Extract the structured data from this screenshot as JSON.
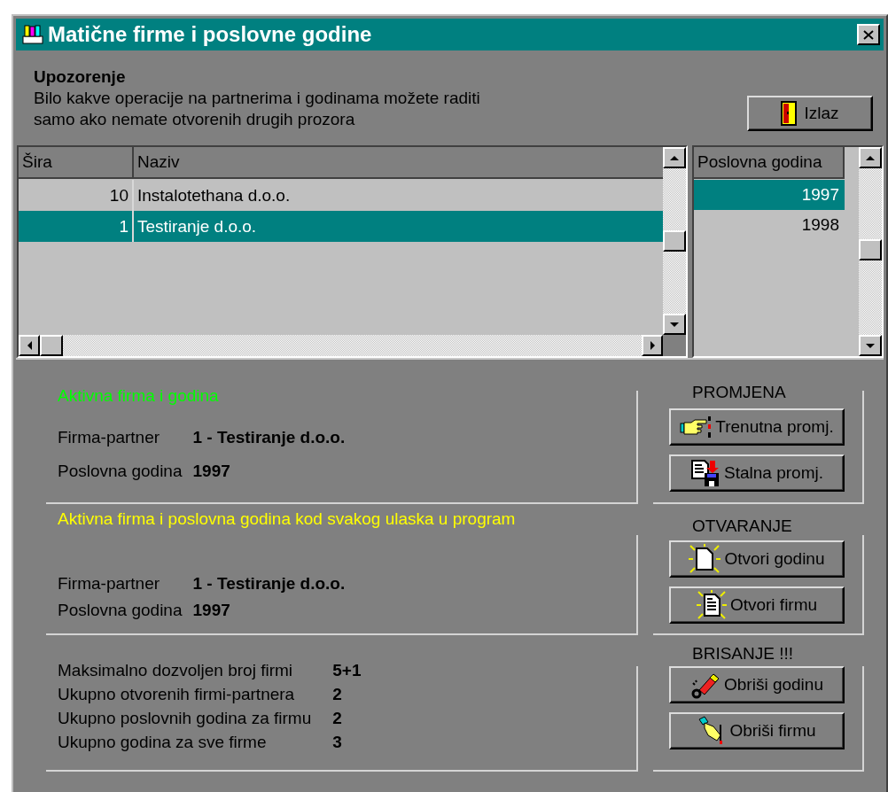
{
  "window": {
    "title": "Matične firme i poslovne godine"
  },
  "warning": {
    "heading": "Upozorenje",
    "lines": [
      "Bilo kakve operacije na partnerima i godinama možete raditi",
      "samo ako nemate otvorenih drugih prozora"
    ]
  },
  "exit_button": {
    "label": "Izlaz"
  },
  "firms_table": {
    "columns": [
      "Šira",
      "Naziv"
    ],
    "rows": [
      {
        "cells": [
          "10",
          "Instalotethana d.o.o."
        ],
        "selected": false
      },
      {
        "cells": [
          "1",
          "Testiranje d.o.o."
        ],
        "selected": true
      }
    ]
  },
  "years_list": {
    "column": "Poslovna godina",
    "items": [
      {
        "label": "1997",
        "selected": true
      },
      {
        "label": "1998",
        "selected": false
      }
    ]
  },
  "sections": [
    {
      "title": "Aktivna firma i godina",
      "color": "#00ff00",
      "fields": [
        {
          "label": "Firma-partner",
          "value": "1 - Testiranje d.o.o."
        },
        {
          "label": "Poslovna godina",
          "value": "1997"
        }
      ],
      "actions": {
        "title": "PROMJENA",
        "buttons": [
          {
            "label": "Trenutna promj.",
            "kind": "hand"
          },
          {
            "label": "Stalna promj.",
            "kind": "save"
          }
        ]
      }
    },
    {
      "title": "Aktivna firma i poslovna godina kod svakog ulaska u program",
      "color": "#ffff00",
      "fields": [
        {
          "label": "Firma-partner",
          "value": "1 - Testiranje d.o.o."
        },
        {
          "label": "Poslovna godina",
          "value": "1997"
        }
      ],
      "actions": {
        "title": "OTVARANJE",
        "buttons": [
          {
            "label": "Otvori godinu",
            "kind": "newdoc"
          },
          {
            "label": "Otvori firmu",
            "kind": "newform"
          }
        ]
      }
    },
    {
      "fields": [
        {
          "label": "Maksimalno dozvoljen broj firmi",
          "value": "5+1"
        },
        {
          "label": "Ukupno otvorenih firmi-partnera",
          "value": "2"
        },
        {
          "label": "Ukupno poslovnih godina za firmu",
          "value": "2"
        },
        {
          "label": "Ukupno godina za sve firme",
          "value": "3"
        }
      ],
      "actions": {
        "title": "BRISANJE !!!",
        "buttons": [
          {
            "label": "Obriši godinu",
            "kind": "eraser"
          },
          {
            "label": "Obriši firmu",
            "kind": "pen"
          }
        ]
      }
    }
  ]
}
